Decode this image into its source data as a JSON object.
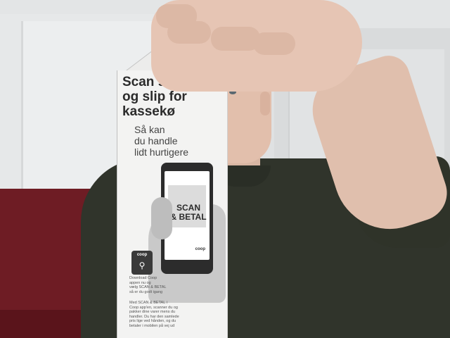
{
  "carton": {
    "headline": "Scan selv\nog slip for\nkassekø",
    "subline": "Så kan\ndu handle\nlidt hurtigere",
    "phone_label": "SCAN\n& BETAL",
    "phone_brand": "coop",
    "app_icon_brand": "coop",
    "app_icon_glyph": "⚲",
    "small_text": "Download Coop\nappen nu og\nvælg SCAN & BETAL\nså er du godt igang",
    "small_text2": "Med SCAN & BETAL i\nCoop app'en, scanner du og\npakker dine varer mens du\nhandler. Du har den samlede\npris lige ved hånden, og du\nbetaler i mobilen på vej ud"
  },
  "colors": {
    "carton": "#f3f3f2",
    "phone": "#2c2c2c",
    "shirt": "#30342b",
    "sofa": "#6e1c24",
    "wall": "#e6e8e9"
  }
}
